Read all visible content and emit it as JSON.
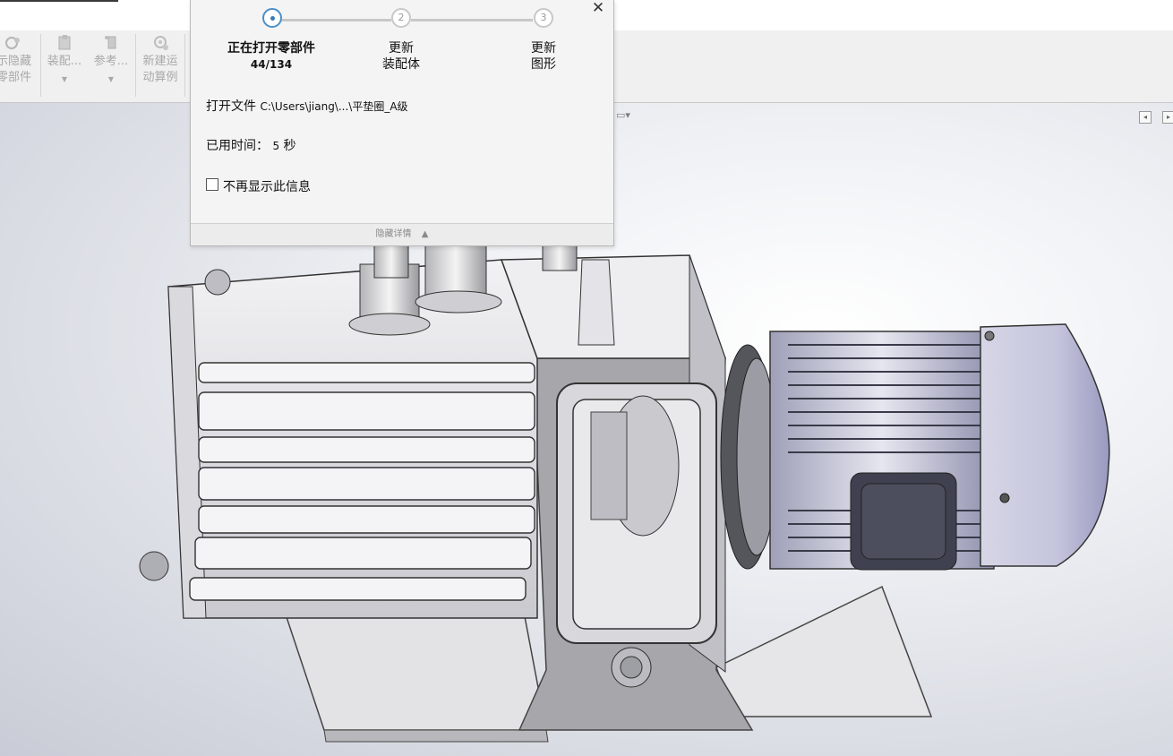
{
  "ribbon": {
    "items": [
      {
        "label1": "示隐藏",
        "label2": "零部件",
        "icon": "show-hide-icon"
      },
      {
        "label1": "装配...",
        "label2": "",
        "icon": "assembly-icon"
      },
      {
        "label1": "参考...",
        "label2": "",
        "icon": "reference-icon"
      },
      {
        "label1": "新建运",
        "label2": "动算例",
        "icon": "new-motion-study-icon"
      }
    ]
  },
  "dialog": {
    "steps": [
      {
        "number": "1",
        "label": "正在打开零部件",
        "count": "44/134",
        "active": true
      },
      {
        "number": "2",
        "label": "更新\n装配体"
      },
      {
        "number": "3",
        "label": "更新\n图形"
      }
    ],
    "file_label": "打开文件",
    "file_path": "C:\\Users\\jiang\\...\\平垫圈_A级",
    "time_label": "已用时间：",
    "time_value": "5",
    "time_unit": "秒",
    "checkbox_label": "不再显示此信息",
    "details_toggle": "隐藏详情",
    "close_glyph": "✕"
  },
  "colors": {
    "accent": "#4a90c8",
    "ribbon_bg": "#f0f0f0",
    "dialog_bg": "#f4f4f4"
  }
}
